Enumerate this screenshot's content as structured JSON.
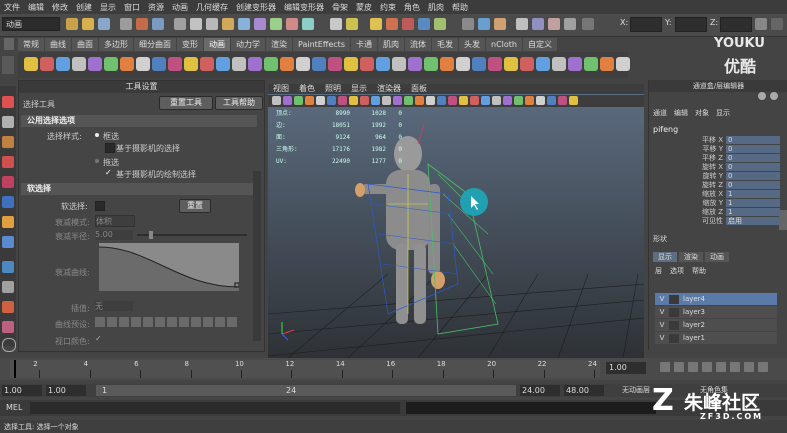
{
  "menubar": [
    "文件",
    "编辑",
    "修改",
    "创建",
    "显示",
    "窗口",
    "资源",
    "动画",
    "几何缓存",
    "创建变形器",
    "编辑变形器",
    "骨架",
    "蒙皮",
    "约束",
    "角色",
    "肌肉",
    "帮助"
  ],
  "toolbar": {
    "mode": "动画",
    "x_label": "X:",
    "y_label": "Y:",
    "z_label": "Z:"
  },
  "watermark": {
    "top": "YOUKU",
    "bottom": "优酷",
    "corner": "朱峰社区",
    "corner_sub": "ZF3D.COM"
  },
  "shelf_tabs": [
    "常规",
    "曲线",
    "曲面",
    "多边形",
    "细分曲面",
    "变形",
    "动画",
    "动力学",
    "渲染",
    "PaintEffects",
    "卡通",
    "肌肉",
    "流体",
    "毛发",
    "头发",
    "nCloth",
    "自定义"
  ],
  "shelf_active": "动画",
  "tool_settings": {
    "title": "工具设置",
    "tool_name": "选择工具",
    "reset_button": "重置工具",
    "help_button": "工具帮助",
    "section_common": "公用选择选项",
    "select_style_label": "选择样式:",
    "opt_marquee": "框选",
    "opt_camera": "基于摄影机的选择",
    "opt_drag": "拖选",
    "opt_drag_camera": "基于摄影机的绘制选择",
    "section_soft": "软选择",
    "soft_label": "软选择:",
    "reset_small": "重置",
    "falloff_mode_label": "衰减模式:",
    "falloff_mode_value": "体积",
    "falloff_radius_label": "衰减半径:",
    "falloff_radius_value": "5.00",
    "falloff_curve_label": "衰减曲线:",
    "interp_label": "插值:",
    "interp_value": "无",
    "curve_preset_label": "曲线预设:",
    "viewport_color_label": "视口颜色:"
  },
  "viewport": {
    "menus": [
      "视图",
      "着色",
      "照明",
      "显示",
      "渲染器",
      "面板"
    ],
    "hud_labels": [
      "顶点:",
      "边:",
      "面:",
      "三角形:",
      "UV:"
    ],
    "hud_col1": [
      "8990",
      "18051",
      "9124",
      "17176",
      "22490"
    ],
    "hud_col2": [
      "1028",
      "1992",
      "964",
      "1982",
      "1277"
    ],
    "hud_col3": [
      "0",
      "0",
      "0",
      "0",
      "0"
    ]
  },
  "channel_box": {
    "title": "通道盒/层编辑器",
    "menus": [
      "通道",
      "编辑",
      "对象",
      "显示"
    ],
    "object_name": "pifeng",
    "attrs": [
      {
        "name": "平移 X",
        "value": "0"
      },
      {
        "name": "平移 Y",
        "value": "0"
      },
      {
        "name": "平移 Z",
        "value": "0"
      },
      {
        "name": "旋转 X",
        "value": "0"
      },
      {
        "name": "旋转 Y",
        "value": "0"
      },
      {
        "name": "旋转 Z",
        "value": "0"
      },
      {
        "name": "缩放 X",
        "value": "1"
      },
      {
        "name": "缩放 Y",
        "value": "1"
      },
      {
        "name": "缩放 Z",
        "value": "1"
      },
      {
        "name": "可见性",
        "value": "启用"
      }
    ],
    "shapes_label": "形状",
    "layer_tabs": [
      "显示",
      "渲染",
      "动画"
    ],
    "layer_menus": [
      "层",
      "选项",
      "帮助"
    ],
    "layers": [
      {
        "v": "V",
        "name": "layer4",
        "selected": true
      },
      {
        "v": "V",
        "name": "layer3",
        "selected": false
      },
      {
        "v": "V",
        "name": "layer2",
        "selected": false
      },
      {
        "v": "V",
        "name": "layer1",
        "selected": false
      }
    ]
  },
  "timeline": {
    "ticks": [
      "2",
      "4",
      "6",
      "8",
      "10",
      "12",
      "14",
      "16",
      "18",
      "20",
      "22",
      "24"
    ],
    "current": "1.00"
  },
  "range": {
    "start": "1.00",
    "start2": "1.00",
    "slider_start": "1",
    "slider_end": "24",
    "end": "24.00",
    "end2": "48.00",
    "anim_layer": "无动画层",
    "char_set": "无角色集"
  },
  "cmdline": {
    "label": "MEL"
  },
  "helpline": {
    "text": "选择工具: 选择一个对象"
  }
}
